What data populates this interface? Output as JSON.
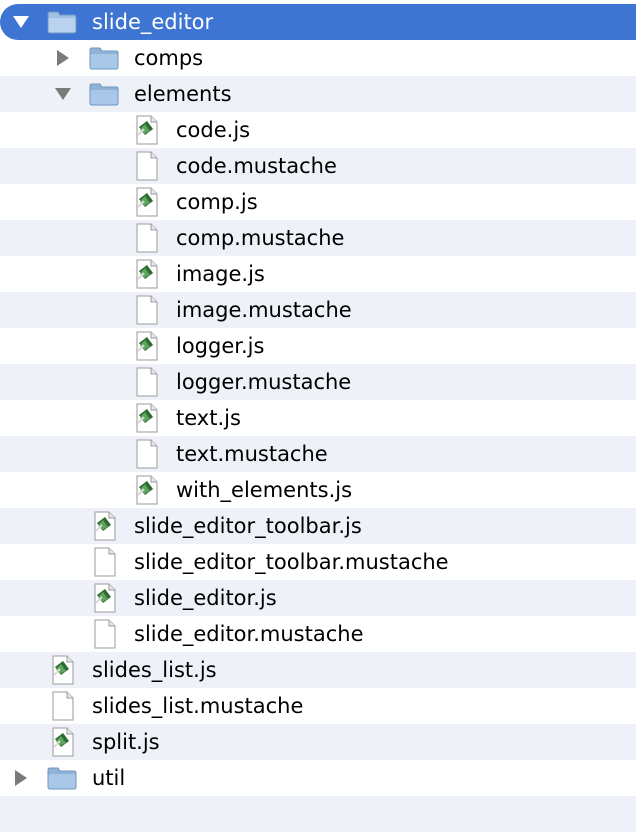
{
  "tree": {
    "root": {
      "label": "slide_editor",
      "expanded": true,
      "icon": "folder-icon"
    },
    "items": [
      {
        "label": "comps",
        "kind": "folder",
        "expanded": false
      },
      {
        "label": "elements",
        "kind": "folder",
        "expanded": true
      },
      {
        "label": "code.js",
        "kind": "js"
      },
      {
        "label": "code.mustache",
        "kind": "file"
      },
      {
        "label": "comp.js",
        "kind": "js"
      },
      {
        "label": "comp.mustache",
        "kind": "file"
      },
      {
        "label": "image.js",
        "kind": "js"
      },
      {
        "label": "image.mustache",
        "kind": "file"
      },
      {
        "label": "logger.js",
        "kind": "js"
      },
      {
        "label": "logger.mustache",
        "kind": "file"
      },
      {
        "label": "text.js",
        "kind": "js"
      },
      {
        "label": "text.mustache",
        "kind": "file"
      },
      {
        "label": "with_elements.js",
        "kind": "js"
      },
      {
        "label": "slide_editor_toolbar.js",
        "kind": "js"
      },
      {
        "label": "slide_editor_toolbar.mustache",
        "kind": "file"
      },
      {
        "label": "slide_editor.js",
        "kind": "js"
      },
      {
        "label": "slide_editor.mustache",
        "kind": "file"
      },
      {
        "label": "slides_list.js",
        "kind": "js"
      },
      {
        "label": "slides_list.mustache",
        "kind": "file"
      },
      {
        "label": "split.js",
        "kind": "js"
      },
      {
        "label": "util",
        "kind": "folder",
        "expanded": false
      }
    ]
  },
  "colors": {
    "selection": "#3e74d2",
    "stripe": "#eef2f8",
    "folder": "#8fb3d6"
  }
}
